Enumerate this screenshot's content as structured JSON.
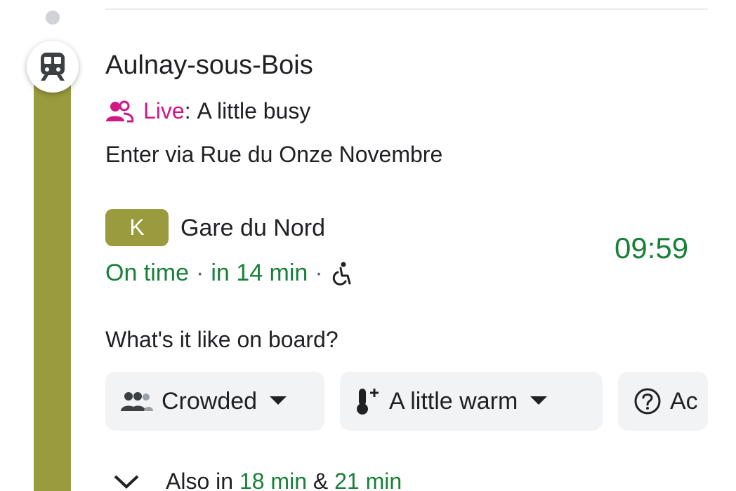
{
  "station": {
    "name": "Aulnay-sous-Bois",
    "live_label": "Live",
    "live_separator": ":",
    "live_status": "A little busy",
    "entrance": "Enter via Rue du Onze Novembre"
  },
  "departure": {
    "line": "K",
    "destination": "Gare du Nord",
    "status": "On time",
    "separator": "·",
    "eta": "in 14 min",
    "time": "09:59"
  },
  "onboard": {
    "question": "What's it like on board?",
    "chips": [
      {
        "label": "Crowded",
        "icon": "people-icon"
      },
      {
        "label": "A little warm",
        "icon": "thermometer-plus-icon"
      },
      {
        "label": "Ac",
        "icon": "question-icon"
      }
    ]
  },
  "also": {
    "label": "Also in",
    "time1": "18 min",
    "amp": "&",
    "time2": "21 min"
  },
  "colors": {
    "line": "#9a9a3e",
    "live": "#d01884",
    "on_time": "#188038",
    "chip_bg": "#f1f3f4"
  }
}
